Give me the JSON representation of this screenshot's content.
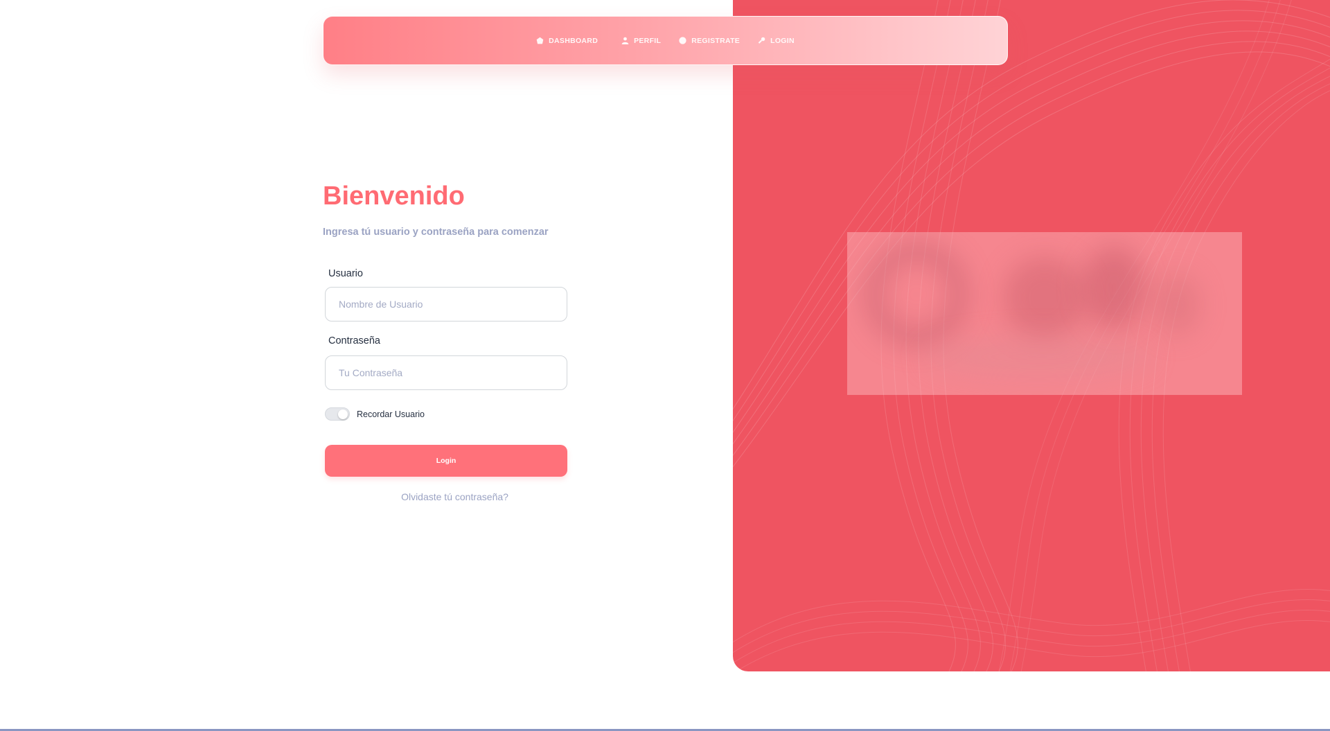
{
  "colors": {
    "accent": "#ff6b73",
    "hero_background": "#ef5461",
    "muted_text": "#9ba3c3",
    "dark_text": "#252f40"
  },
  "navbar": {
    "items": [
      {
        "label": "DASHBOARD",
        "icon": "dashboard-icon"
      },
      {
        "label": "PERFIL",
        "icon": "user-icon"
      },
      {
        "label": "REGISTRATE",
        "icon": "user-circle-icon"
      },
      {
        "label": "LOGIN",
        "icon": "key-icon"
      }
    ]
  },
  "login": {
    "title": "Bienvenido",
    "subtitle": "Ingresa tú usuario y contraseña para comenzar",
    "username_label": "Usuario",
    "username_placeholder": "Nombre de Usuario",
    "password_label": "Contraseña",
    "password_placeholder": "Tu Contraseña",
    "remember_label": "Recordar Usuario",
    "button_label": "Login",
    "forgot_link": "Olvidaste tú contraseña?"
  }
}
